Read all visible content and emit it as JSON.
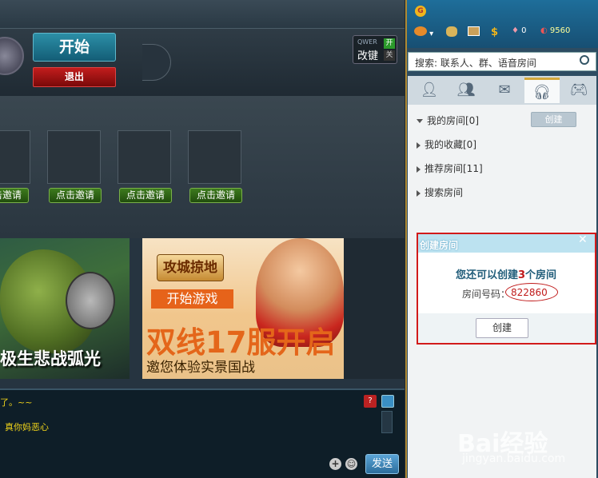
{
  "game": {
    "start_label": "开始",
    "quit_label": "退出",
    "keymap": {
      "brand": "QWER",
      "label": "改键",
      "on": "开",
      "off": "关"
    },
    "invite_label": "点击邀请",
    "banner_left_text": "极生悲战弧光",
    "banner_right": {
      "logo": "攻城掠地",
      "start_label": "开始游戏",
      "headline": "双线17服开启",
      "subline": "邀您体验实景国战"
    },
    "chat": {
      "line1": "了。~~",
      "line2": "真你妈恶心",
      "help_label": "?",
      "send_label": "发送"
    }
  },
  "client": {
    "toolbar": {
      "beans": "0",
      "gold": "9560"
    },
    "search": {
      "placeholder": "搜索: 联系人、群、语音房间"
    },
    "rooms": {
      "my_rooms": "我的房间[0]",
      "create_label": "创建",
      "favorites": "我的收藏[0]",
      "recommended": "推荐房间[11]",
      "search_room": "搜索房间"
    },
    "popup": {
      "title": "创建房间",
      "quota_prefix": "您还可以创建",
      "quota_count": "3",
      "quota_suffix": "个房间",
      "room_no_label": "房间号码：",
      "room_no": "822860",
      "create_label": "创建"
    }
  },
  "watermark": {
    "brand": "Bai经验",
    "url": "jingyan.baidu.com"
  }
}
